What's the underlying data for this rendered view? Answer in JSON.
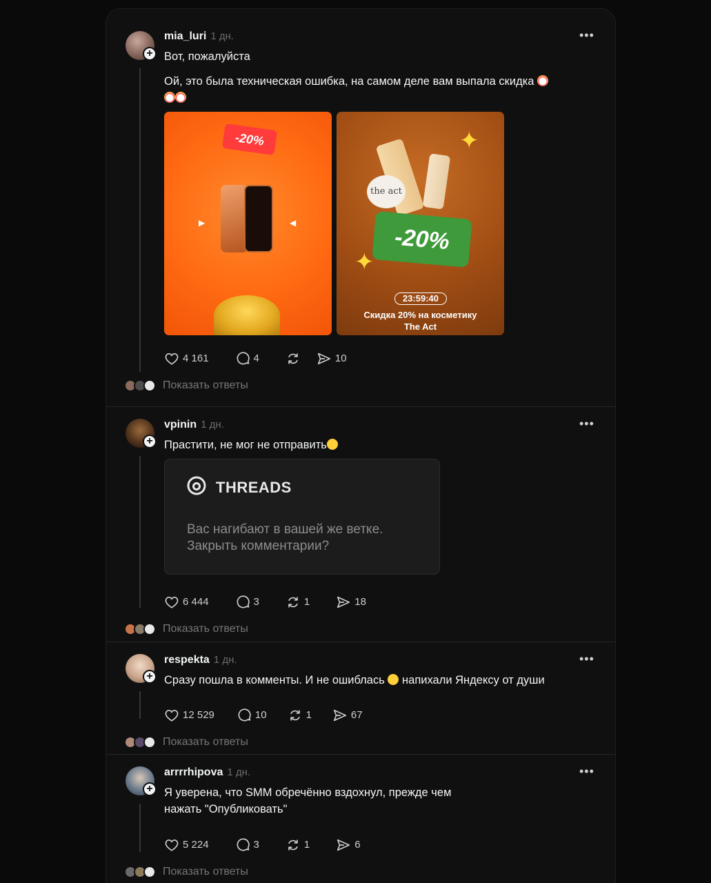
{
  "posts": [
    {
      "username": "mia_luri",
      "time": "1 дн.",
      "text": "Вот, пожалуйста",
      "text2": "Ой, это была техническая ошибка, на самом деле вам выпала скидка",
      "images": {
        "left": {
          "tag": "-20%"
        },
        "right": {
          "jar_text": "the act",
          "tag": "-20%",
          "timer": "23:59:40",
          "caption_line1": "Скидка 20% на косметику",
          "caption_line2": "The Act"
        }
      },
      "likes": "4 161",
      "comments": "4",
      "reposts": "",
      "shares": "10",
      "show_replies": "Показать ответы"
    },
    {
      "username": "vpinin",
      "time": "1 дн.",
      "text": "Прастити, не мог не отправить",
      "card": {
        "brand": "THREADS",
        "line1": "Вас нагибают в вашей же ветке.",
        "line2": "Закрыть комментарии?"
      },
      "likes": "6 444",
      "comments": "3",
      "reposts": "1",
      "shares": "18",
      "show_replies": "Показать ответы"
    },
    {
      "username": "respekta",
      "time": "1 дн.",
      "text_a": "Сразу пошла в комменты. И не ошиблась",
      "text_b": "напихали Яндексу от души",
      "likes": "12 529",
      "comments": "10",
      "reposts": "1",
      "shares": "67",
      "show_replies": "Показать ответы"
    },
    {
      "username": "arrrrhipova",
      "time": "1 дн.",
      "text_line1": "Я уверена, что SMM обречённо вздохнул, прежде чем",
      "text_line2": "нажать \"Опубликовать\"",
      "likes": "5 224",
      "comments": "3",
      "reposts": "1",
      "shares": "6",
      "show_replies": "Показать ответы"
    }
  ],
  "more_icon": "•••",
  "colors": {
    "background": "#101010",
    "text": "#f3f5f7",
    "muted": "#777777"
  }
}
